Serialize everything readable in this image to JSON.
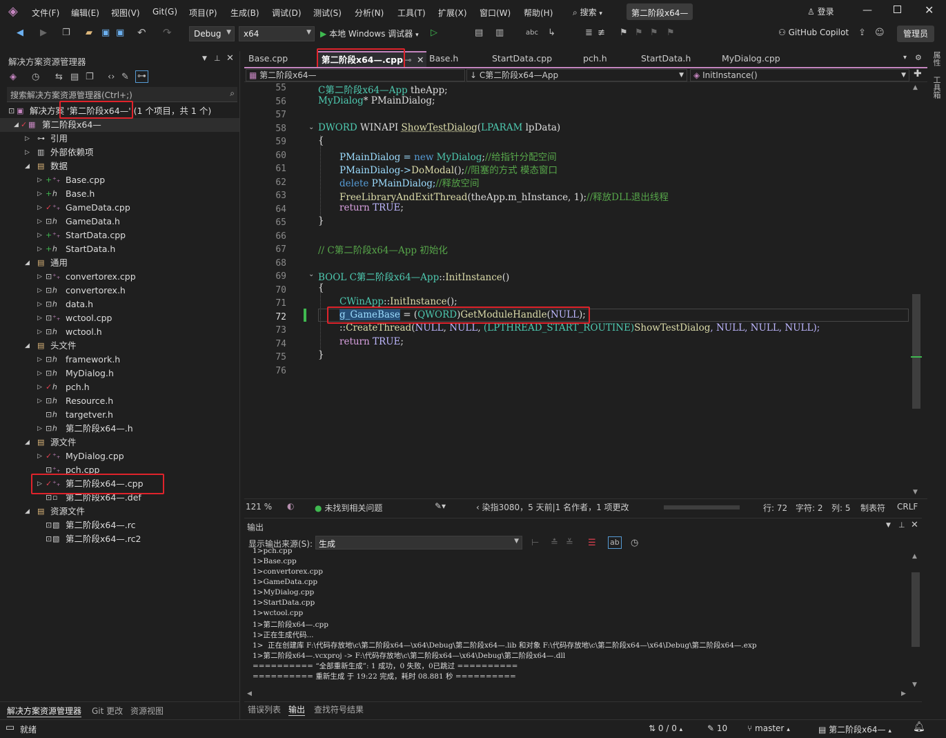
{
  "menu": [
    "文件(F)",
    "编辑(E)",
    "视图(V)",
    "Git(G)",
    "项目(P)",
    "生成(B)",
    "调试(D)",
    "测试(S)",
    "分析(N)",
    "工具(T)",
    "扩展(X)",
    "窗口(W)",
    "帮助(H)"
  ],
  "search_label": "搜索",
  "title": "第二阶段x64—",
  "login": "登录",
  "toolbar": {
    "config": "Debug",
    "platform": "x64",
    "run": "本地 Windows 调试器",
    "copilot": "GitHub Copilot",
    "admin": "管理员"
  },
  "solution_panel": {
    "title": "解决方案资源管理器",
    "search_placeholder": "搜索解决方案资源管理器(Ctrl+;)",
    "solution_label": "解决方案 '第二阶段x64—' (1 个项目，共 1 个)",
    "project": "第二阶段x64—",
    "items": [
      "引用",
      "外部依赖项",
      "数据",
      "Base.cpp",
      "Base.h",
      "GameData.cpp",
      "GameData.h",
      "StartData.cpp",
      "StartData.h",
      "通用",
      "convertorex.cpp",
      "convertorex.h",
      "data.h",
      "wctool.cpp",
      "wctool.h",
      "头文件",
      "framework.h",
      "MyDialog.h",
      "pch.h",
      "Resource.h",
      "targetver.h",
      "第二阶段x64—.h",
      "源文件",
      "MyDialog.cpp",
      "pch.cpp",
      "第二阶段x64—.cpp",
      "第二阶段x64—.def",
      "资源文件",
      "第二阶段x64—.rc",
      "第二阶段x64—.rc2"
    ],
    "bottom_tabs": [
      "解决方案资源管理器",
      "Git 更改",
      "资源视图"
    ]
  },
  "side_tabs": [
    "属性",
    "工具箱"
  ],
  "tabs": [
    "Base.cpp",
    "第二阶段x64—.cpp",
    "Base.h",
    "StartData.cpp",
    "pch.h",
    "StartData.h",
    "MyDialog.cpp"
  ],
  "nav": {
    "project": "第二阶段x64—",
    "class": "C第二阶段x64—App",
    "member": "InitInstance()"
  },
  "line_numbers": [
    "55",
    "56",
    "57",
    "58",
    "59",
    "60",
    "61",
    "62",
    "63",
    "64",
    "65",
    "66",
    "67",
    "68",
    "69",
    "70",
    "71",
    "72",
    "73",
    "74",
    "75",
    "76"
  ],
  "code": {
    "l55a": "C第二阶段x64—App",
    "l55b": " theApp;",
    "l56a": "MyDialog",
    "l56b": "* PMainDialog;",
    "l58a": "DWORD",
    "l58b": " WINAPI ",
    "l58c": "ShowTestDialog",
    "l58d": "(",
    "l58e": "LPARAM",
    "l58f": " lpData)",
    "l59": "{",
    "l60a": "PMainDialog = ",
    "l60b": "new ",
    "l60c": "MyDialog",
    "l60d": ";",
    "l60e": "//给指针分配空间",
    "l61a": "PMainDialog->",
    "l61b": "DoModal",
    "l61c": "();",
    "l61d": "//阻塞的方式 模态窗口",
    "l62a": "delete ",
    "l62b": "PMainDialog;",
    "l62c": "//释放空间",
    "l63a": "FreeLibraryAndExitThread",
    "l63b": "(theApp.m_hInstance, 1);",
    "l63c": "//释放DLL退出线程",
    "l64a": "return ",
    "l64b": "TRUE",
    ";": ";",
    "l65": "}",
    "l67": "// C第二阶段x64—App 初始化",
    "l69a": "BOOL ",
    "l69b": "C第二阶段x64—App",
    "l69c": "::",
    "l69d": "InitInstance",
    "l69e": "()",
    "l70": "{",
    "l71a": "CWinApp",
    "l71b": "::",
    "l71c": "InitInstance",
    "l71d": "();",
    "l72a": "g_GameBase",
    "l72b": " = (",
    "l72c": "QWORD",
    ")": ")",
    "l72d": "GetModuleHandle",
    "l72e": "(",
    "l72f": "NULL",
    "l72g": ");",
    "l73a": "::",
    "l73b": "CreateThread",
    "l73c": "(",
    "l73d": "NULL",
    ", ": ", ",
    "l73e": "NULL",
    "l73f": "(LPTHREAD_START_ROUTINE)",
    "l73g": "ShowTestDialog",
    "l73h": ", NULL, NULL, NULL);",
    "l74a": "return ",
    "l74b": "TRUE",
    "l74c": ";",
    "l75": "}"
  },
  "editor_status": {
    "zoom": "121 %",
    "issues": "未找到相关问题",
    "blame": "染指3080，5 天前|1 名作者，1 项更改",
    "line": "行: 72",
    "char": "字符: 2",
    "col": "列: 5",
    "tabs": "制表符",
    "eol": "CRLF"
  },
  "output": {
    "title": "输出",
    "source_label": "显示输出来源(S):",
    "source_value": "生成",
    "lines": [
      "1>pch.cpp",
      "1>Base.cpp",
      "1>convertorex.cpp",
      "1>GameData.cpp",
      "1>MyDialog.cpp",
      "1>StartData.cpp",
      "1>wctool.cpp",
      "1>第二阶段x64—.cpp",
      "1>正在生成代码...",
      "1>  正在创建库 F:\\代码存放地\\c\\第二阶段x64—\\x64\\Debug\\第二阶段x64—.lib 和对象 F:\\代码存放地\\c\\第二阶段x64—\\x64\\Debug\\第二阶段x64—.exp",
      "1>第二阶段x64—.vcxproj -> F:\\代码存放地\\c\\第二阶段x64—\\x64\\Debug\\第二阶段x64—.dll",
      "========== “全部重新生成”: 1 成功，0 失败，0已跳过 ==========",
      "========== 重新生成 于 19:22 完成，耗时 08.881 秒 =========="
    ],
    "bottom_tabs": [
      "错误列表",
      "输出",
      "查找符号结果"
    ]
  },
  "status": {
    "ready": "就绪",
    "changes": "0 / 0",
    "commits": "10",
    "branch": "master",
    "repo": "第二阶段x64—"
  },
  "colors": {
    "accent": "#c586c0",
    "red_box": "#e0232b",
    "panel": "#1f1f1f",
    "editor": "#1f1f1f"
  }
}
